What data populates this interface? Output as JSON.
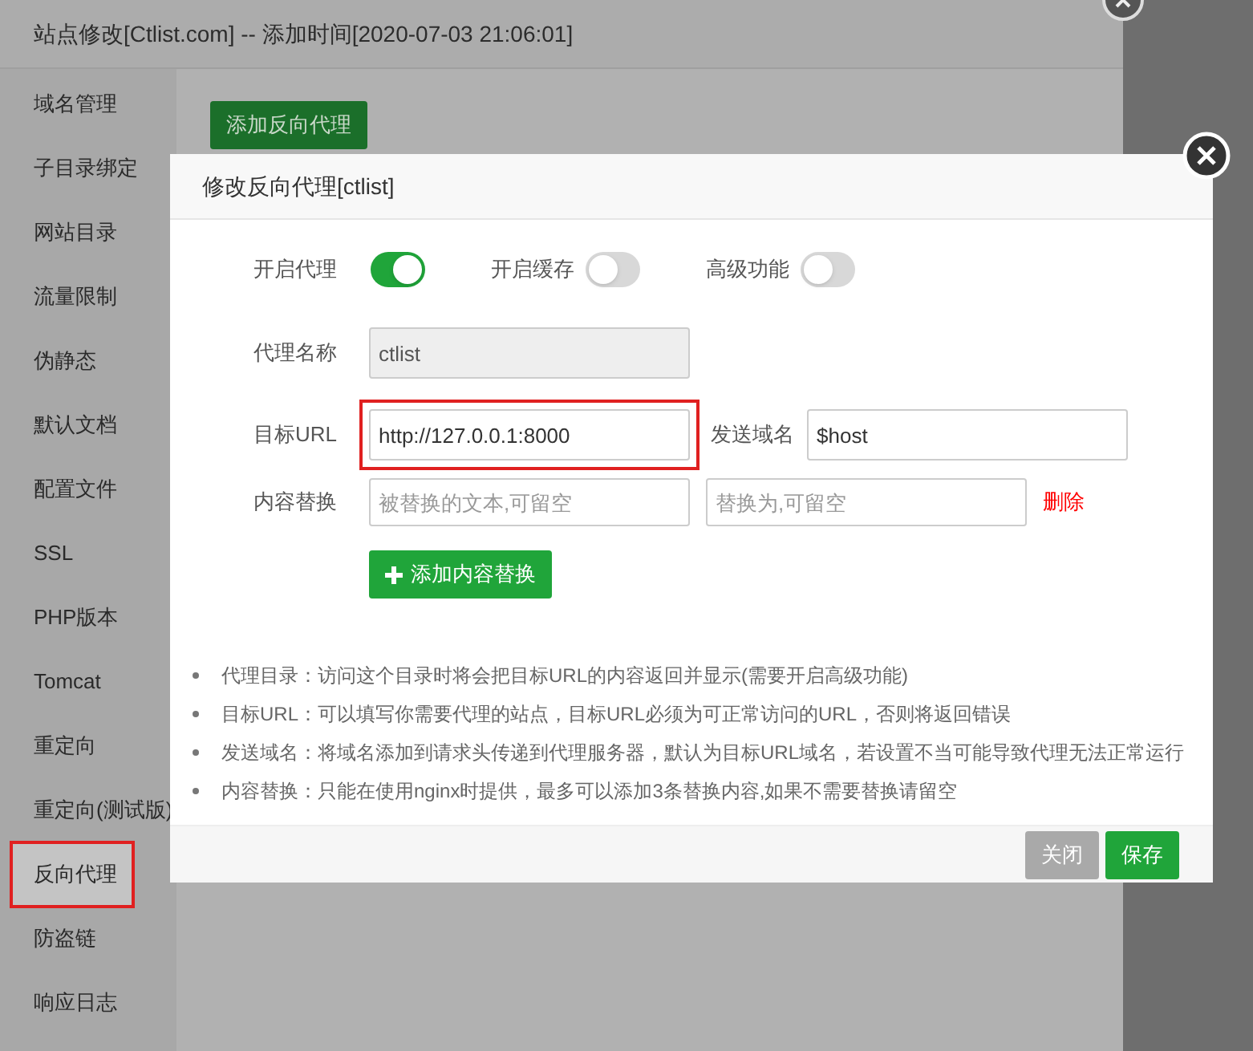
{
  "outer_window": {
    "title": "站点修改[Ctlist.com] -- 添加时间[2020-07-03 21:06:01]",
    "add_button": "添加反向代理"
  },
  "sidebar": {
    "items": [
      {
        "label": "域名管理",
        "selected": false,
        "highlighted": false
      },
      {
        "label": "子目录绑定",
        "selected": false,
        "highlighted": false
      },
      {
        "label": "网站目录",
        "selected": false,
        "highlighted": false
      },
      {
        "label": "流量限制",
        "selected": false,
        "highlighted": false
      },
      {
        "label": "伪静态",
        "selected": false,
        "highlighted": false
      },
      {
        "label": "默认文档",
        "selected": false,
        "highlighted": false
      },
      {
        "label": "配置文件",
        "selected": false,
        "highlighted": false
      },
      {
        "label": "SSL",
        "selected": false,
        "highlighted": false
      },
      {
        "label": "PHP版本",
        "selected": false,
        "highlighted": false
      },
      {
        "label": "Tomcat",
        "selected": false,
        "highlighted": false
      },
      {
        "label": "重定向",
        "selected": false,
        "highlighted": false
      },
      {
        "label": "重定向(测试版)",
        "selected": false,
        "highlighted": false
      },
      {
        "label": "反向代理",
        "selected": true,
        "highlighted": true
      },
      {
        "label": "防盗链",
        "selected": false,
        "highlighted": false
      },
      {
        "label": "响应日志",
        "selected": false,
        "highlighted": false
      }
    ]
  },
  "dialog": {
    "title": "修改反向代理[ctlist]",
    "toggles": [
      {
        "label": "开启代理",
        "on": true
      },
      {
        "label": "开启缓存",
        "on": false
      },
      {
        "label": "高级功能",
        "on": false
      }
    ],
    "proxy_name": {
      "label": "代理名称",
      "value": "ctlist",
      "disabled": true
    },
    "target_url": {
      "label": "目标URL",
      "value": "http://127.0.0.1:8000",
      "highlighted": true
    },
    "send_domain": {
      "label": "发送域名",
      "value": "$host"
    },
    "content_replace": {
      "label": "内容替换",
      "placeholder_from": "被替换的文本,可留空",
      "placeholder_to": "替换为,可留空",
      "delete": "删除"
    },
    "add_replace_button": "添加内容替换",
    "notes": [
      "代理目录：访问这个目录时将会把目标URL的内容返回并显示(需要开启高级功能)",
      "目标URL：可以填写你需要代理的站点，目标URL必须为可正常访问的URL，否则将返回错误",
      "发送域名：将域名添加到请求头传递到代理服务器，默认为目标URL域名，若设置不当可能导致代理无法正常运行",
      "内容替换：只能在使用nginx时提供，最多可以添加3条替换内容,如果不需要替换请留空"
    ],
    "buttons": [
      {
        "label": "关闭",
        "kind": "secondary"
      },
      {
        "label": "保存",
        "kind": "primary"
      }
    ]
  }
}
